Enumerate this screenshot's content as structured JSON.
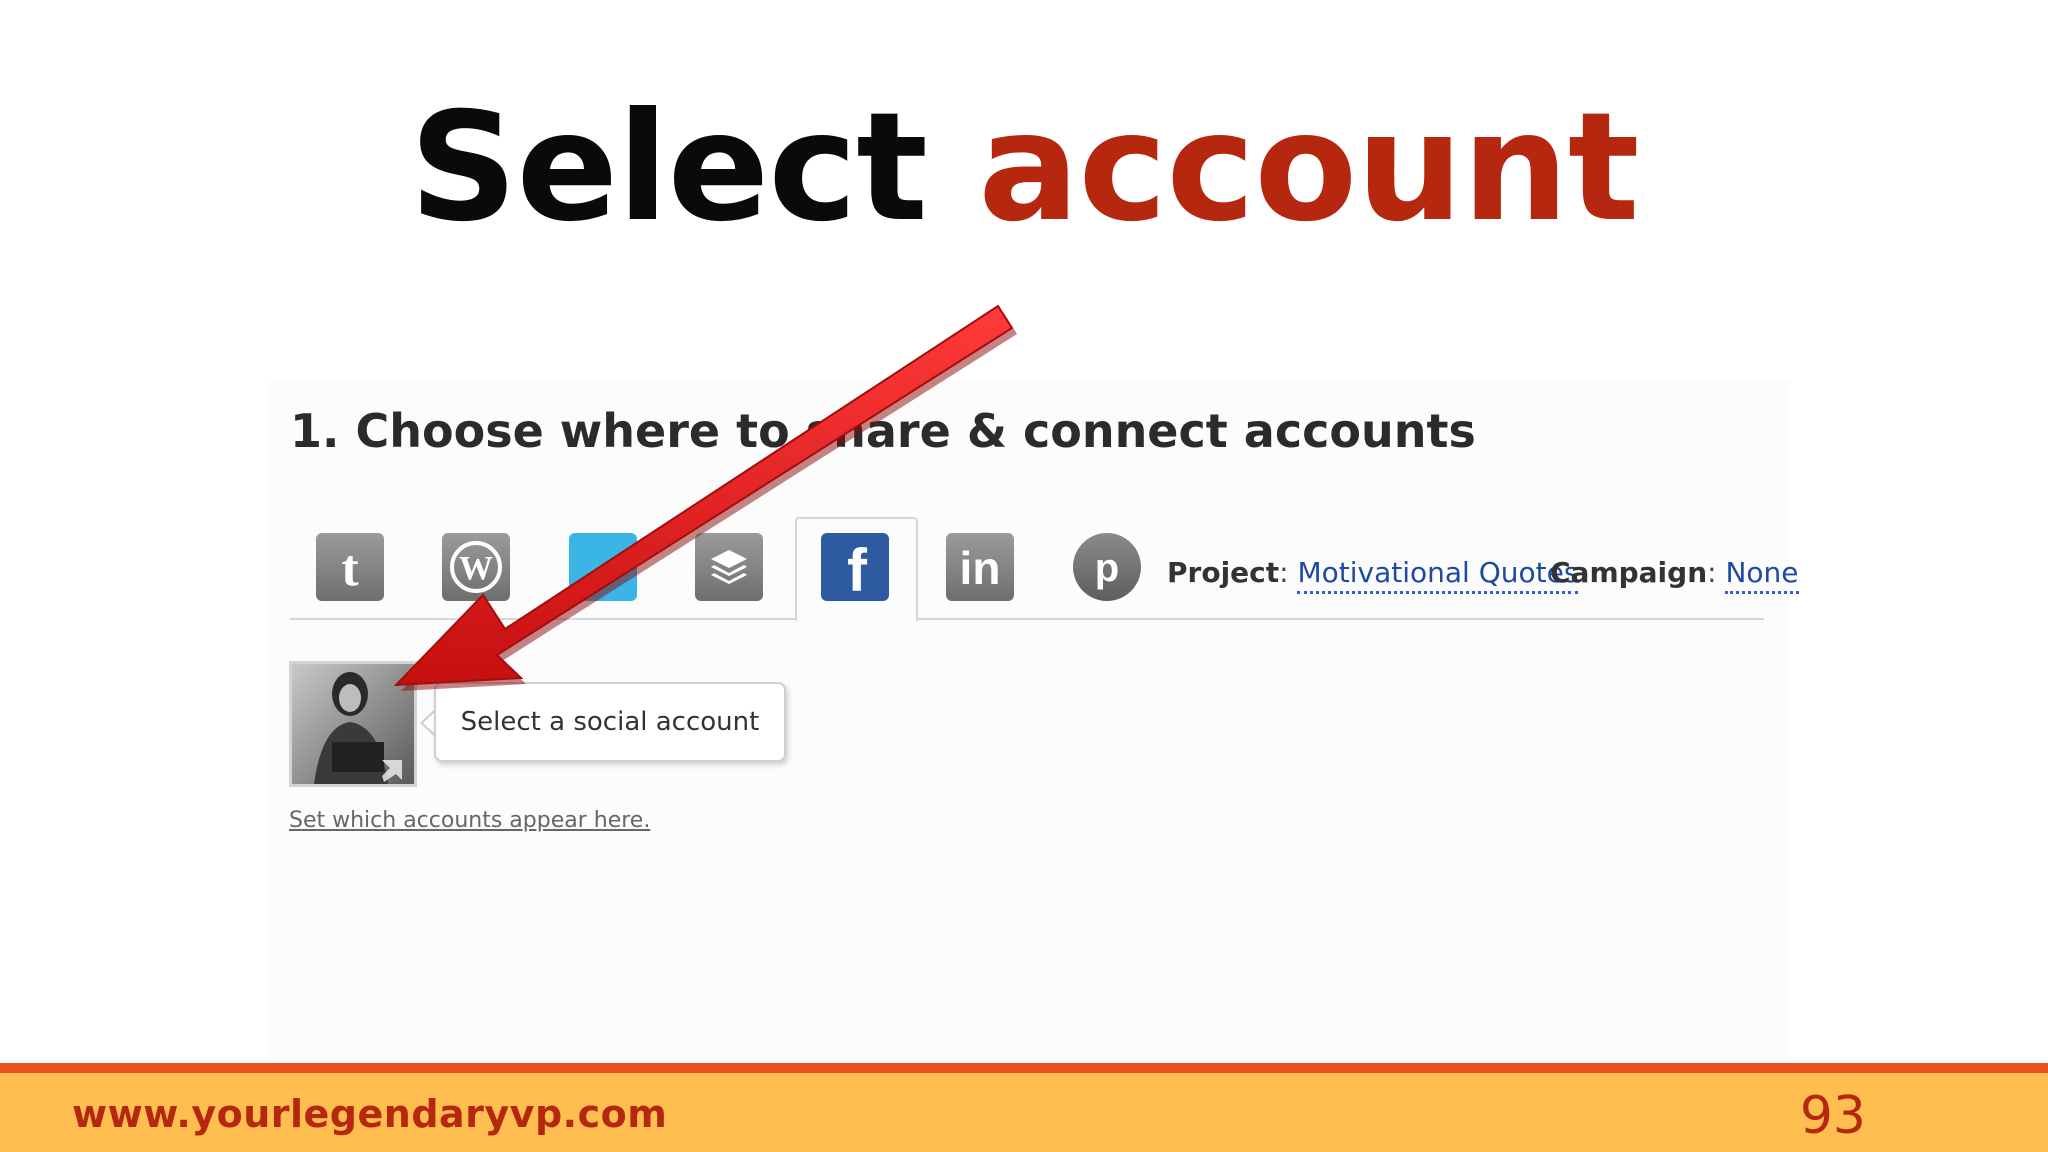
{
  "slide": {
    "title_part1": "Select",
    "title_part2": "account",
    "footer_url": "www.yourlegendaryvp.com",
    "page_number": "93"
  },
  "share_panel": {
    "heading": "1. Choose where to share & connect accounts",
    "networks": [
      {
        "name": "tumblr",
        "icon": "tumblr-icon"
      },
      {
        "name": "wordpress",
        "icon": "wordpress-icon"
      },
      {
        "name": "twitter",
        "icon": "twitter-icon"
      },
      {
        "name": "buffer",
        "icon": "buffer-icon"
      },
      {
        "name": "facebook",
        "icon": "facebook-icon",
        "active": true
      },
      {
        "name": "linkedin",
        "icon": "linkedin-icon"
      },
      {
        "name": "pinterest",
        "icon": "pinterest-icon"
      }
    ],
    "project_label": "Project",
    "project_value": "Motivational Quotes",
    "campaign_label": "Campaign",
    "campaign_value": "None",
    "tooltip": "Select a social account",
    "set_accounts_link": "Set which accounts appear here"
  },
  "colors": {
    "title_accent": "#b5280f",
    "footer_bar": "#ffbe4f",
    "footer_line": "#e8511f",
    "facebook": "#2d5aa0",
    "twitter": "#3bb4e6",
    "arrow": "#e11a1a"
  }
}
